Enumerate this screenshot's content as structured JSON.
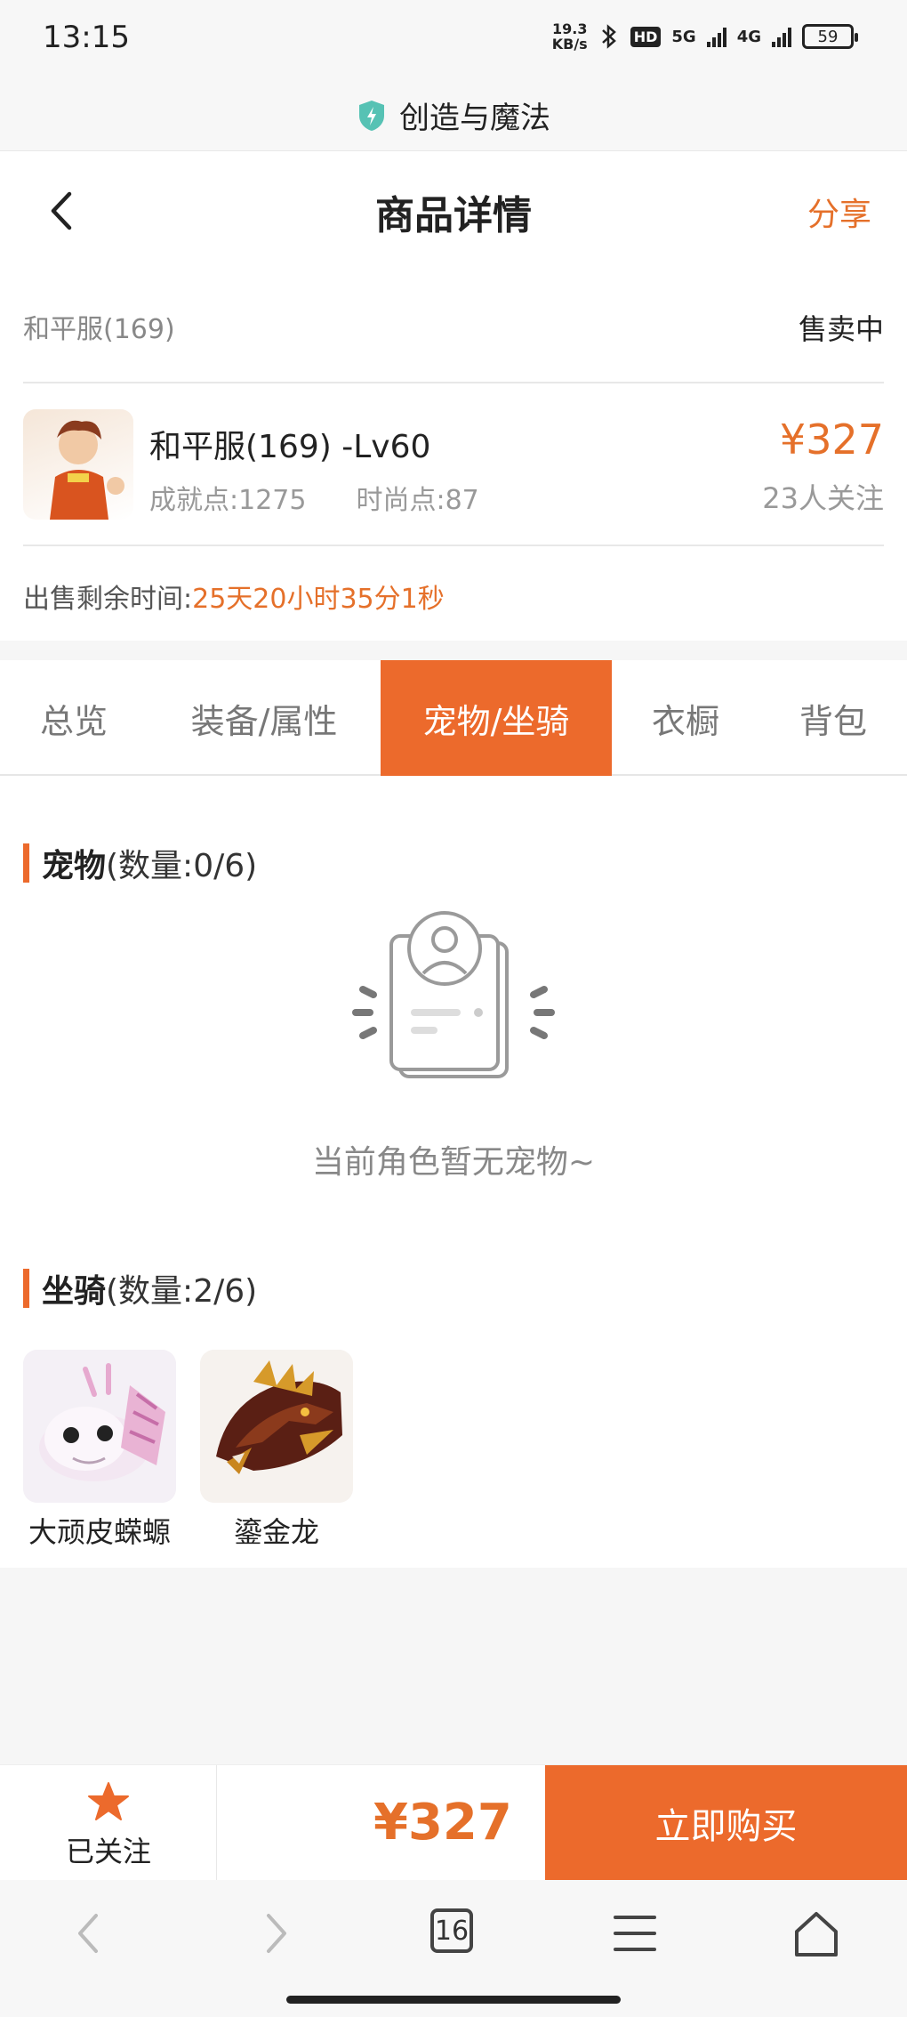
{
  "status_bar": {
    "time": "13:15",
    "net_speed_value": "19.3",
    "net_speed_unit": "KB/s",
    "hd_label": "HD",
    "signal_5g": "5G",
    "signal_4g": "4G",
    "battery": "59"
  },
  "app_bar": {
    "title": "创造与魔法"
  },
  "header": {
    "title": "商品详情",
    "share_label": "分享"
  },
  "item": {
    "server": "和平服(169)",
    "sale_status": "售卖中",
    "name": "和平服(169) -Lv60",
    "achievement": "成就点:1275",
    "fashion": "时尚点:87",
    "price": "¥327",
    "followers": "23人关注",
    "time_left_label": "出售剩余时间:",
    "time_left_value": "25天20小时35分1秒"
  },
  "tabs": [
    {
      "label": "总览",
      "active": false
    },
    {
      "label": "装备/属性",
      "active": false
    },
    {
      "label": "宠物/坐骑",
      "active": true
    },
    {
      "label": "衣橱",
      "active": false
    },
    {
      "label": "背包",
      "active": false
    }
  ],
  "pets": {
    "title": "宠物",
    "count": "(数量:0/6)",
    "empty_text": "当前角色暂无宠物~"
  },
  "mounts": {
    "title": "坐骑",
    "count": "(数量:2/6)",
    "items": [
      {
        "name": "大顽皮蝾螈"
      },
      {
        "name": "鎏金龙"
      }
    ]
  },
  "bottom_bar": {
    "follow_label": "已关注",
    "price": "¥327",
    "buy_label": "立即购买"
  },
  "browser_bar": {
    "tab_count": "16"
  },
  "colors": {
    "accent": "#ec6a2c",
    "price": "#e5702a"
  }
}
